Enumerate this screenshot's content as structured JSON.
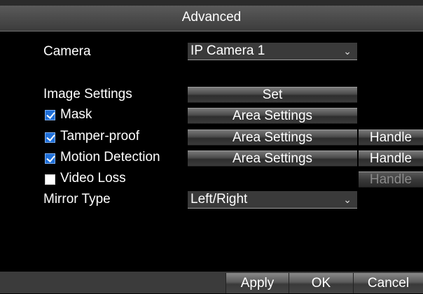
{
  "window": {
    "title": "Advanced"
  },
  "camera": {
    "label": "Camera",
    "value": "IP Camera 1"
  },
  "image_settings": {
    "label": "Image Settings",
    "button": "Set"
  },
  "mask": {
    "label": "Mask",
    "checked": true,
    "area_button": "Area Settings"
  },
  "tamper": {
    "label": "Tamper-proof",
    "checked": true,
    "area_button": "Area Settings",
    "handle_button": "Handle"
  },
  "motion": {
    "label": "Motion Detection",
    "checked": true,
    "area_button": "Area Settings",
    "handle_button": "Handle"
  },
  "video_loss": {
    "label": "Video Loss",
    "checked": false,
    "handle_button": "Handle"
  },
  "mirror": {
    "label": "Mirror Type",
    "value": "Left/Right"
  },
  "footer": {
    "apply": "Apply",
    "ok": "OK",
    "cancel": "Cancel"
  },
  "icons": {
    "dropdown": "chevron-down-icon",
    "checkbox": "checkbox-icon"
  }
}
